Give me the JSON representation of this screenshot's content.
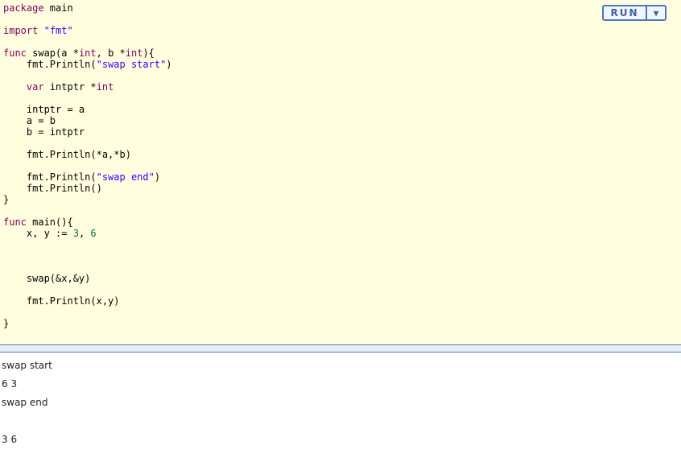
{
  "editor": {
    "lines": [
      [
        {
          "t": "package",
          "c": "kw"
        },
        {
          "t": " main",
          "c": ""
        }
      ],
      [],
      [
        {
          "t": "import",
          "c": "kw"
        },
        {
          "t": " ",
          "c": ""
        },
        {
          "t": "\"fmt\"",
          "c": "str"
        }
      ],
      [],
      [
        {
          "t": "func",
          "c": "kw"
        },
        {
          "t": " swap(a *",
          "c": ""
        },
        {
          "t": "int",
          "c": "kw"
        },
        {
          "t": ", b *",
          "c": ""
        },
        {
          "t": "int",
          "c": "kw"
        },
        {
          "t": "){",
          "c": ""
        }
      ],
      [
        {
          "t": "    fmt.Println(",
          "c": ""
        },
        {
          "t": "\"swap start\"",
          "c": "str"
        },
        {
          "t": ")",
          "c": ""
        }
      ],
      [],
      [
        {
          "t": "    ",
          "c": ""
        },
        {
          "t": "var",
          "c": "kw"
        },
        {
          "t": " intptr *",
          "c": ""
        },
        {
          "t": "int",
          "c": "kw"
        }
      ],
      [],
      [
        {
          "t": "    intptr = a",
          "c": ""
        }
      ],
      [
        {
          "t": "    a = b",
          "c": ""
        }
      ],
      [
        {
          "t": "    b = intptr",
          "c": ""
        }
      ],
      [],
      [
        {
          "t": "    fmt.Println(*a,*b)",
          "c": ""
        }
      ],
      [],
      [
        {
          "t": "    fmt.Println(",
          "c": ""
        },
        {
          "t": "\"swap end\"",
          "c": "str"
        },
        {
          "t": ")",
          "c": ""
        }
      ],
      [
        {
          "t": "    fmt.Println()",
          "c": ""
        }
      ],
      [
        {
          "t": "}",
          "c": ""
        }
      ],
      [],
      [
        {
          "t": "func",
          "c": "kw"
        },
        {
          "t": " main(){",
          "c": ""
        }
      ],
      [
        {
          "t": "    x, y := ",
          "c": ""
        },
        {
          "t": "3",
          "c": "num"
        },
        {
          "t": ", ",
          "c": ""
        },
        {
          "t": "6",
          "c": "num"
        }
      ],
      [],
      [],
      [],
      [
        {
          "t": "    swap(&x,&y)",
          "c": ""
        }
      ],
      [],
      [
        {
          "t": "    fmt.Println(x,y)",
          "c": ""
        }
      ],
      [],
      [
        {
          "t": "}",
          "c": ""
        }
      ]
    ]
  },
  "toolbar": {
    "run_label": "RUN",
    "dropdown_glyph": "▼"
  },
  "output": {
    "lines": [
      "swap start",
      "6 3",
      "swap end",
      "",
      "3 6"
    ]
  }
}
